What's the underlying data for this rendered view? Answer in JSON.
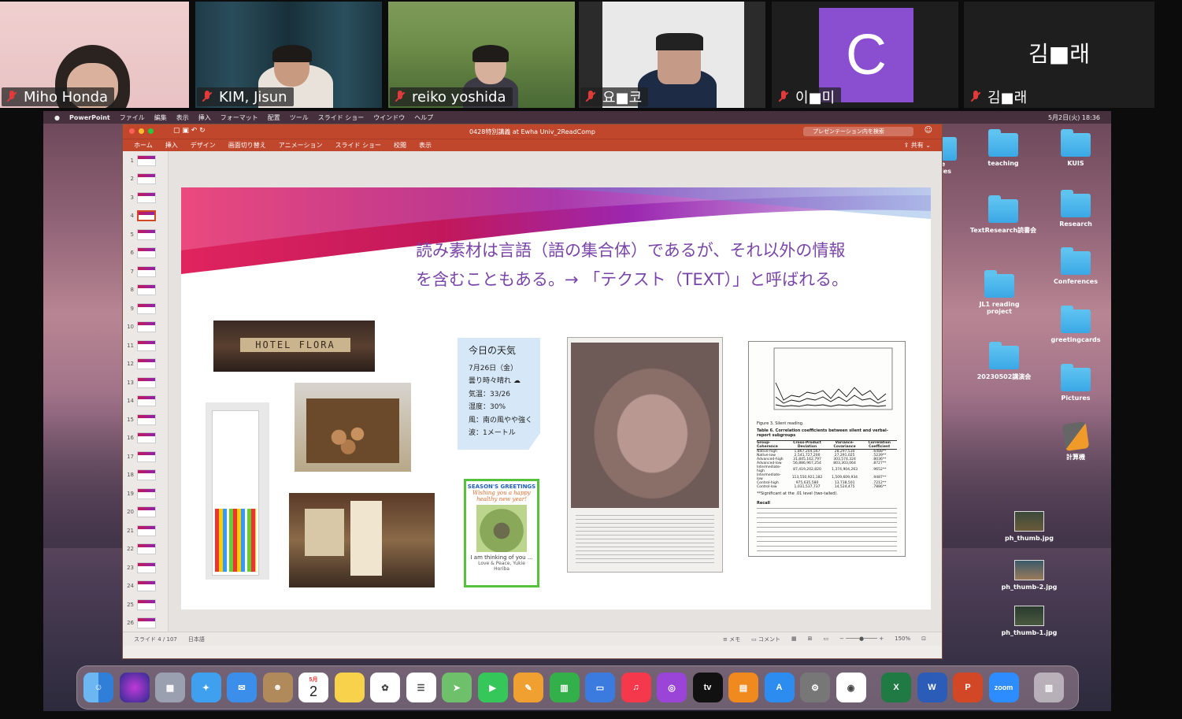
{
  "participants": [
    {
      "name": "Miho Honda",
      "muted": true
    },
    {
      "name": "KIM, Jisun",
      "muted": true
    },
    {
      "name": "reiko yoshida",
      "muted": true
    },
    {
      "name": "요■코",
      "muted": true
    },
    {
      "name": "이■미",
      "muted": true,
      "avatar_letter": "C",
      "avatar_color": "#8a4fd1"
    },
    {
      "name": "김■래",
      "muted": true,
      "big_name": "김■래"
    }
  ],
  "mac_menubar": {
    "app": "PowerPoint",
    "menus": [
      "ファイル",
      "編集",
      "表示",
      "挿入",
      "フォーマット",
      "配置",
      "ツール",
      "スライド ショー",
      "ウインドウ",
      "ヘルプ"
    ],
    "clock": "5月2日(火) 18:36"
  },
  "ppt": {
    "window_title": "0428特別講義 at Ewha Univ_2ReadComp",
    "search_placeholder": "プレゼンテーション内を検索",
    "ribbon_tabs": [
      "ホーム",
      "挿入",
      "デザイン",
      "画面切り替え",
      "アニメーション",
      "スライド ショー",
      "校閲",
      "表示"
    ],
    "share_label": "共有",
    "status_slide": "スライド 4 / 107",
    "status_lang": "日本語",
    "status_notes": "メモ",
    "status_comments": "コメント",
    "zoom": "150%",
    "accent_color": "#c0462c",
    "selected_slide": 4
  },
  "slide": {
    "heading_line1": "読み素材は言語（語の集合体）であるが、それ以外の情報",
    "heading_line2": "を含むこともある。→ 「テクスト（TEXT）」と呼ばれる。",
    "hotel_sign": "HOTEL FLORA",
    "weather": {
      "title": "今日の天気",
      "lines": [
        "7月26日（金）",
        "曇り時々晴れ",
        "気温：33/26",
        "湿度：30%",
        "風：南の風やや強く",
        "波：1メートル"
      ]
    },
    "card": {
      "line1": "SEASON'S GREETINGS",
      "line2": "Wishing you a happy healthy new year!",
      "line3": "I am thinking of you ...",
      "line4": "Love & Peace, Yukie Horiba"
    },
    "paper": {
      "figure_caption": "Figure 3.   Silent reading.",
      "table_title": "Table 6.   Correlation coefficients between silent and verbal-report subgroups",
      "columns": [
        "Group-Coherence",
        "Cross-Product Deviation",
        "Variance-Covariance",
        "Correlation Coefficient"
      ],
      "rows": [
        [
          "Native-high",
          "1,867,204,567",
          "28,297,530",
          ".6488**"
        ],
        [
          "Native-low",
          "2,541,727,200",
          "27,291,025",
          ".5239**"
        ],
        [
          "Advanced-high",
          "31,845,162,797",
          "303,574,324",
          ".8036**"
        ],
        [
          "Advanced-low",
          "56,886,967,254",
          "803,303,064",
          ".8727**"
        ],
        [
          "Intermediate-high",
          "87,419,202,820",
          "1,374,904,263",
          ".9652**"
        ],
        [
          "Intermediate-low",
          "113,550,921,182",
          "1,509,609,934",
          ".9487**"
        ],
        [
          "Control-high",
          "975,635,580",
          "13,738,501",
          ".7212**"
        ],
        [
          "Control-low",
          "1,031,537,737",
          "14,524,475",
          ".7886**"
        ]
      ],
      "note": "**Significant at the .01 level (two-tailed).",
      "section": "Recall"
    }
  },
  "desktop": {
    "icons": [
      {
        "label": "teaching",
        "type": "folder"
      },
      {
        "label": "KUIS",
        "type": "folder"
      },
      {
        "label": "uswe al_files",
        "type": "folder"
      },
      {
        "label": "TextResearch読書会",
        "type": "folder"
      },
      {
        "label": "Research",
        "type": "folder"
      },
      {
        "label": "Conferences",
        "type": "folder"
      },
      {
        "label": "JL1 reading project",
        "type": "folder"
      },
      {
        "label": "greetingcards",
        "type": "folder"
      },
      {
        "label": "20230502講演会",
        "type": "folder"
      },
      {
        "label": "Pictures",
        "type": "folder"
      },
      {
        "label": "計算機",
        "type": "app"
      },
      {
        "label": "ph_thumb.jpg",
        "type": "image"
      },
      {
        "label": "ph_thumb-2.jpg",
        "type": "image"
      },
      {
        "label": "ph_thumb-1.jpg",
        "type": "image"
      }
    ]
  },
  "dock": {
    "calendar_month": "5月",
    "calendar_day": "2",
    "apps": [
      "Finder",
      "Siri",
      "Launchpad",
      "Safari",
      "Mail",
      "Contacts",
      "Calendar",
      "Notes",
      "Photos",
      "Reminders",
      "Maps",
      "FaceTime",
      "Pages",
      "Numbers",
      "Keynote",
      "Music",
      "Podcasts",
      "TV",
      "Books",
      "App Store",
      "System Preferences",
      "Chrome",
      "Excel",
      "Word",
      "PowerPoint",
      "Zoom",
      "Trash"
    ],
    "zoom_label": "zoom"
  }
}
